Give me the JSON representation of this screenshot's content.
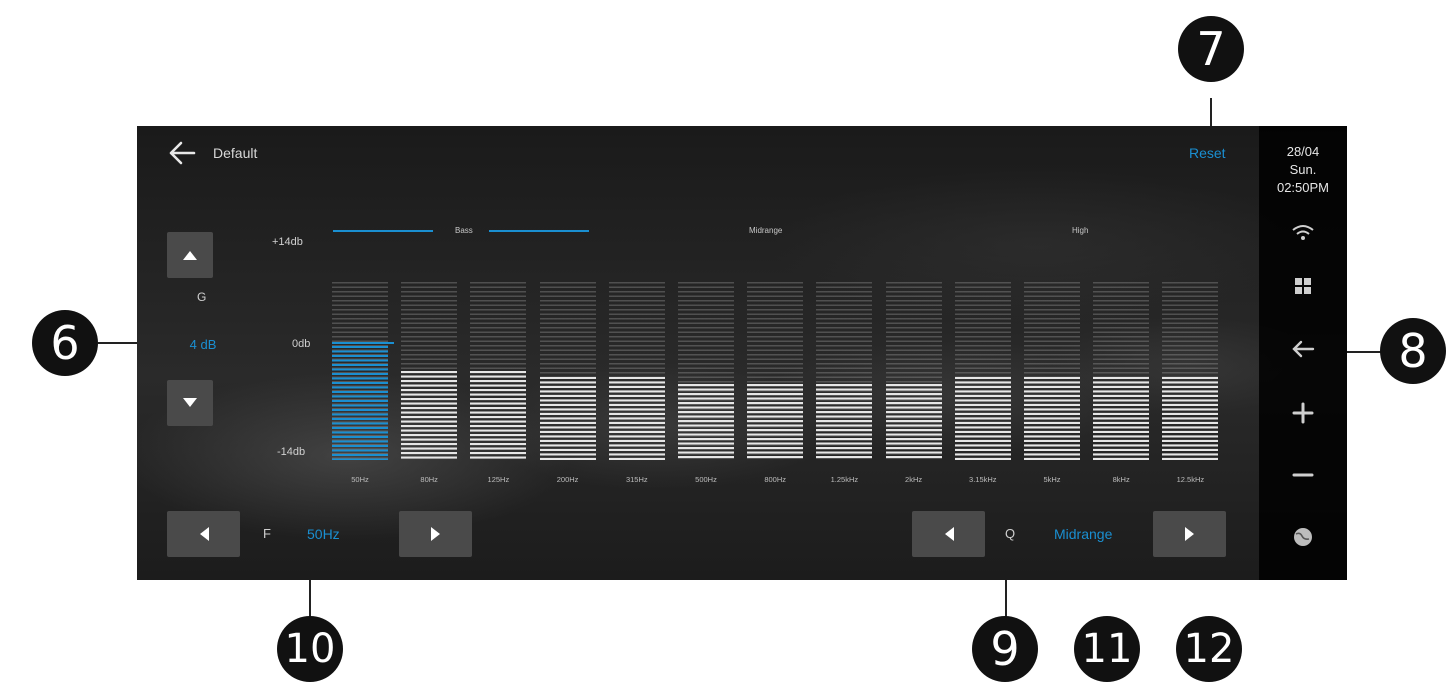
{
  "top_bar": {
    "preset": "Default",
    "reset_label": "Reset"
  },
  "status": {
    "date": "28/04",
    "day": "Sun.",
    "time": "02:50PM"
  },
  "side_icons": [
    "wifi-icon",
    "grid-icon",
    "back-arrow-icon",
    "volume-up-icon",
    "volume-down-icon",
    "globe-icon"
  ],
  "gain": {
    "label": "G",
    "value": "4 dB"
  },
  "scale": {
    "top": "+14db",
    "zero": "0db",
    "bottom": "-14db"
  },
  "bands": {
    "bass": "Bass",
    "midrange": "Midrange",
    "high": "High"
  },
  "eq": {
    "selected_index": 0,
    "range_db": [
      -14,
      14
    ],
    "columns": [
      {
        "freq": "50Hz",
        "gain_db": 4
      },
      {
        "freq": "80Hz",
        "gain_db": 0
      },
      {
        "freq": "125Hz",
        "gain_db": 0
      },
      {
        "freq": "200Hz",
        "gain_db": -1
      },
      {
        "freq": "315Hz",
        "gain_db": -1
      },
      {
        "freq": "500Hz",
        "gain_db": -2
      },
      {
        "freq": "800Hz",
        "gain_db": -2
      },
      {
        "freq": "1.25kHz",
        "gain_db": -2
      },
      {
        "freq": "2kHz",
        "gain_db": -2
      },
      {
        "freq": "3.15kHz",
        "gain_db": -1
      },
      {
        "freq": "5kHz",
        "gain_db": -1
      },
      {
        "freq": "8kHz",
        "gain_db": -1
      },
      {
        "freq": "12.5kHz",
        "gain_db": -1
      }
    ]
  },
  "frequency": {
    "label": "F",
    "value": "50Hz"
  },
  "q_factor": {
    "label": "Q",
    "value": "Midrange"
  },
  "callouts": {
    "c6": "6",
    "c7": "7",
    "c8": "8",
    "c9": "9",
    "c10": "10",
    "c11": "11",
    "c12": "12"
  }
}
